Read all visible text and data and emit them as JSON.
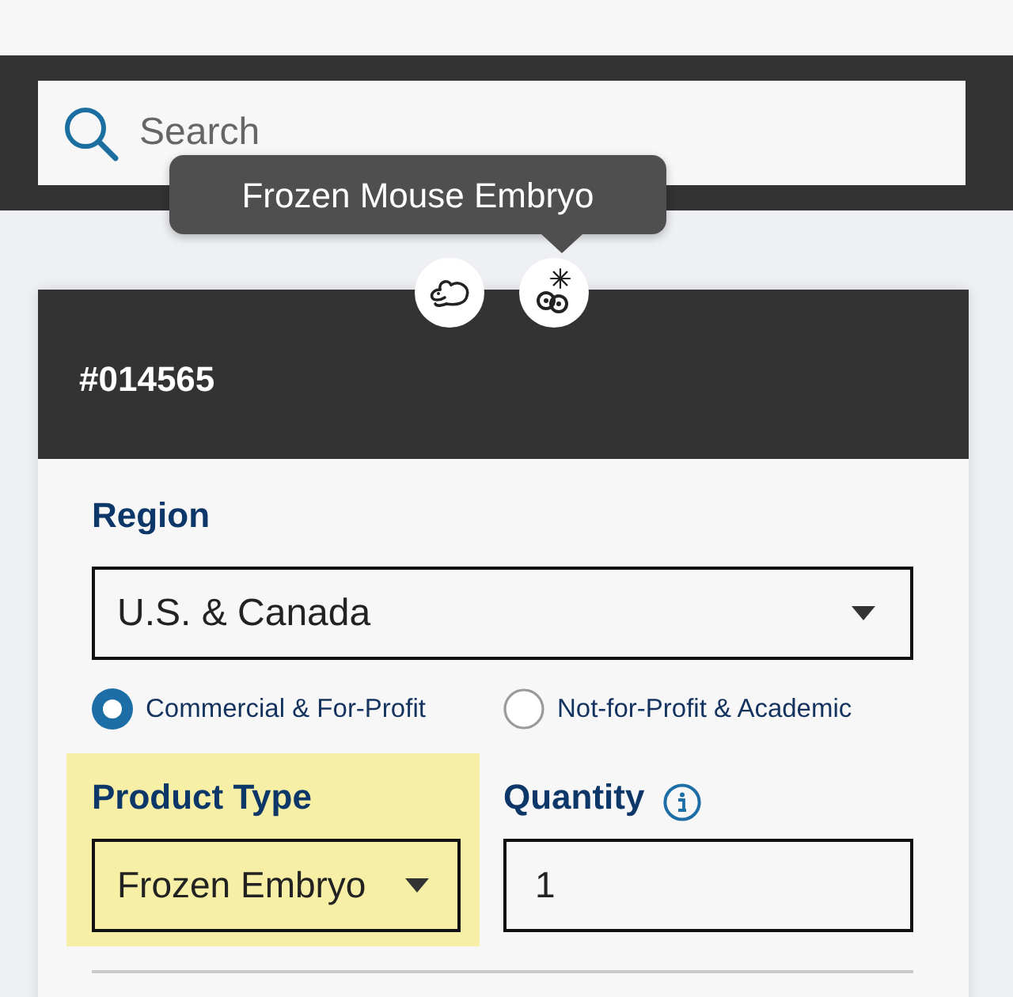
{
  "search": {
    "placeholder": "Search"
  },
  "tooltip": {
    "text": "Frozen Mouse Embryo"
  },
  "product_icons": [
    {
      "kind": "mouse"
    },
    {
      "kind": "frozen_embryo"
    }
  ],
  "card": {
    "title": "#014565"
  },
  "region": {
    "label": "Region",
    "value": "U.S. & Canada"
  },
  "customer_types": [
    {
      "label": "Commercial & For-Profit",
      "selected": true
    },
    {
      "label": "Not-for-Profit & Academic",
      "selected": false
    }
  ],
  "product_type": {
    "label": "Product Type",
    "value": "Frozen Embryo",
    "highlighted": true
  },
  "quantity": {
    "label": "Quantity",
    "value": "1"
  }
}
